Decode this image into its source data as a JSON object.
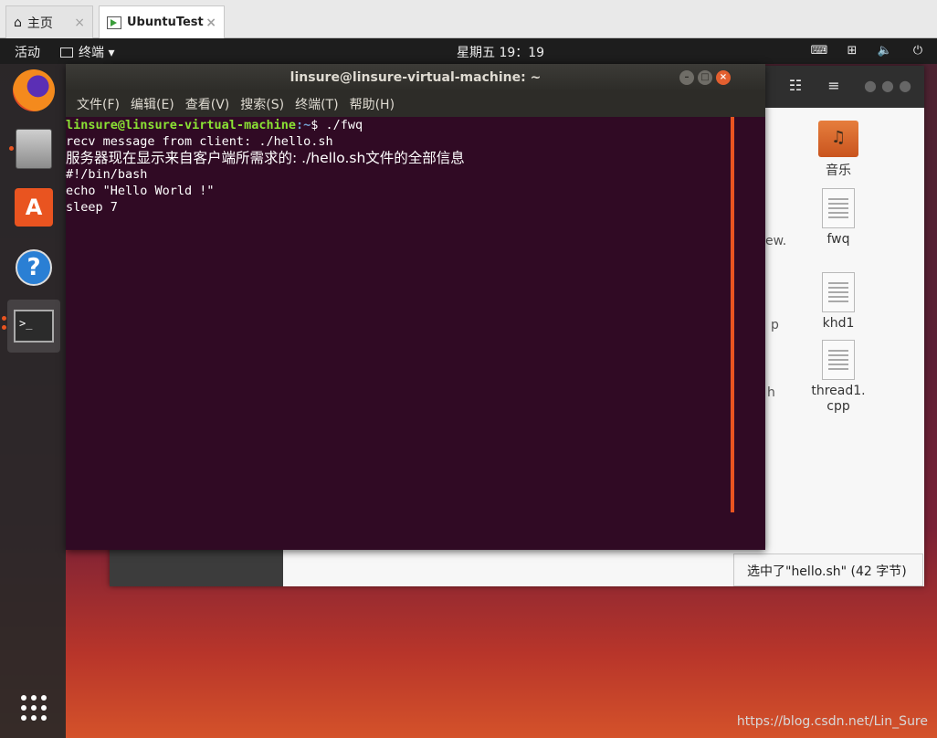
{
  "vm_tabs": {
    "home_label": "主页",
    "ubuntu_label": "UbuntuTest",
    "close_glyph": "×"
  },
  "top_panel": {
    "activities": "活动",
    "app_menu": "终端 ▾",
    "clock": "星期五 19：19"
  },
  "terminal": {
    "title": "linsure@linsure-virtual-machine: ~",
    "menu": [
      "文件(F)",
      "编辑(E)",
      "查看(V)",
      "搜索(S)",
      "终端(T)",
      "帮助(H)"
    ],
    "prompt_user": "linsure@linsure-virtual-machine",
    "prompt_path": ":~",
    "prompt_symbol": "$ ",
    "command": "./fwq",
    "lines": [
      "recv message from client: ./hello.sh",
      "服务器现在显示来自客户端所需求的: ./hello.sh文件的全部信息",
      "#!/bin/bash",
      "echo \"Hello World !\"",
      "sleep 7"
    ]
  },
  "files": {
    "items": [
      "音乐",
      "fwq",
      "khd1",
      "thread1.\ncpp"
    ],
    "partial_labels": [
      "ew.",
      "p",
      "h"
    ],
    "status": "选中了\"hello.sh\" (42 字节)"
  },
  "watermark": "https://blog.csdn.net/Lin_Sure",
  "colors": {
    "ubuntu_orange": "#e95420",
    "terminal_bg": "#300a24",
    "prompt_green": "#8ae234",
    "prompt_blue": "#729fcf"
  }
}
